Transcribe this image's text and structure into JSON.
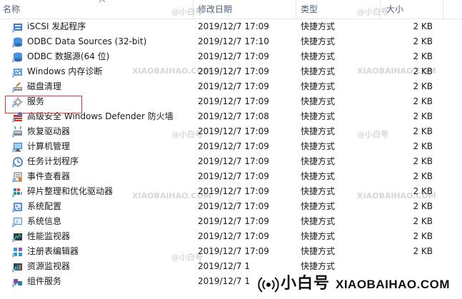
{
  "header": {
    "name": "名称",
    "modified": "修改日期",
    "type": "类型",
    "size": "大小"
  },
  "files": [
    {
      "name": "iSCSI 发起程序",
      "date": "2019/12/7 17:09",
      "type": "快捷方式",
      "size": "2 KB",
      "icon": "iscsi-icon"
    },
    {
      "name": "ODBC Data Sources (32-bit)",
      "date": "2019/12/7 17:10",
      "type": "快捷方式",
      "size": "2 KB",
      "icon": "odbc-icon"
    },
    {
      "name": "ODBC 数据源(64 位)",
      "date": "2019/12/7 17:09",
      "type": "快捷方式",
      "size": "2 KB",
      "icon": "odbc-icon"
    },
    {
      "name": "Windows 内存诊断",
      "date": "2019/12/7 17:09",
      "type": "快捷方式",
      "size": "2 KB",
      "icon": "memory-diagnostic-icon"
    },
    {
      "name": "磁盘清理",
      "date": "2019/12/7 17:09",
      "type": "快捷方式",
      "size": "2 KB",
      "icon": "disk-cleanup-icon"
    },
    {
      "name": "服务",
      "date": "2019/12/7 17:09",
      "type": "快捷方式",
      "size": "2 KB",
      "icon": "services-gear-icon"
    },
    {
      "name": "高级安全 Windows Defender 防火墙",
      "date": "2019/12/7 17:08",
      "type": "快捷方式",
      "size": "2 KB",
      "icon": "firewall-icon"
    },
    {
      "name": "恢复驱动器",
      "date": "2019/12/7 17:09",
      "type": "快捷方式",
      "size": "2 KB",
      "icon": "recovery-drive-icon"
    },
    {
      "name": "计算机管理",
      "date": "2019/12/7 17:09",
      "type": "快捷方式",
      "size": "2 KB",
      "icon": "computer-management-icon"
    },
    {
      "name": "任务计划程序",
      "date": "2019/12/7 17:09",
      "type": "快捷方式",
      "size": "2 KB",
      "icon": "task-scheduler-icon"
    },
    {
      "name": "事件查看器",
      "date": "2019/12/7 17:09",
      "type": "快捷方式",
      "size": "2 KB",
      "icon": "event-viewer-icon"
    },
    {
      "name": "碎片整理和优化驱动器",
      "date": "2019/12/7 17:09",
      "type": "快捷方式",
      "size": "2 KB",
      "icon": "defrag-icon"
    },
    {
      "name": "系统配置",
      "date": "2019/12/7 17:09",
      "type": "快捷方式",
      "size": "2 KB",
      "icon": "system-config-icon"
    },
    {
      "name": "系统信息",
      "date": "2019/12/7 17:09",
      "type": "快捷方式",
      "size": "2 KB",
      "icon": "system-info-icon"
    },
    {
      "name": "性能监视器",
      "date": "2019/12/7 17:09",
      "type": "快捷方式",
      "size": "2 KB",
      "icon": "performance-monitor-icon"
    },
    {
      "name": "注册表编辑器",
      "date": "2019/12/7 17:09",
      "type": "快捷方式",
      "size": "2 KB",
      "icon": "registry-editor-icon"
    },
    {
      "name": "资源监视器",
      "date": "2019/12/7 1",
      "type": "快捷方式",
      "size": "",
      "icon": "resource-monitor-icon"
    },
    {
      "name": "组件服务",
      "date": "2019/12/7 1",
      "type": "快捷方式",
      "size": "",
      "icon": "component-services-icon"
    }
  ],
  "watermark": {
    "cn": "@小白号",
    "en": "XIAOBAIHAO.COM"
  },
  "logo": {
    "text": "小白号",
    "site": "XIAOBAIHAO.COM"
  },
  "colors": {
    "highlight_border": "#d23b3b",
    "header_text": "#4c607a"
  }
}
